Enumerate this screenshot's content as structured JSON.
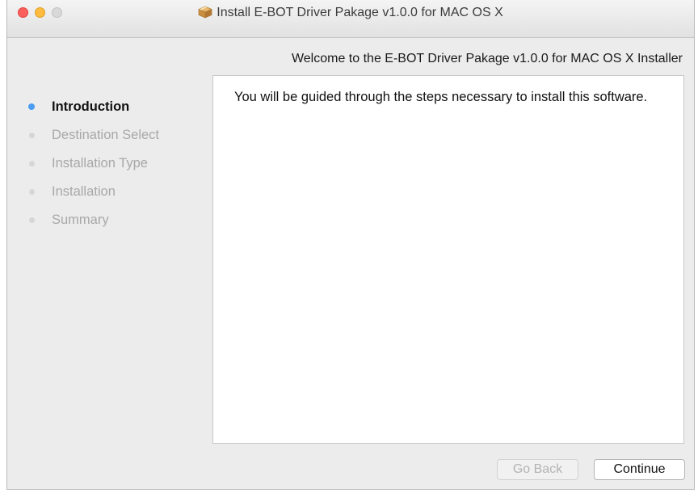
{
  "window": {
    "title": "Install E-BOT Driver Pakage v1.0.0 for MAC OS X",
    "title_icon": "package-installer-icon"
  },
  "heading": "Welcome to the E-BOT Driver Pakage v1.0.0 for MAC OS X Installer",
  "steps": [
    {
      "label": "Introduction",
      "active": true
    },
    {
      "label": "Destination Select",
      "active": false
    },
    {
      "label": "Installation Type",
      "active": false
    },
    {
      "label": "Installation",
      "active": false
    },
    {
      "label": "Summary",
      "active": false
    }
  ],
  "content": {
    "text": "You will be guided through the steps necessary to install this software."
  },
  "buttons": {
    "go_back": "Go Back",
    "continue": "Continue"
  },
  "colors": {
    "active_step": "#4a9df0",
    "close": "#fc605c",
    "minimize": "#fdbc40",
    "zoom_disabled": "#d9d9d9"
  }
}
